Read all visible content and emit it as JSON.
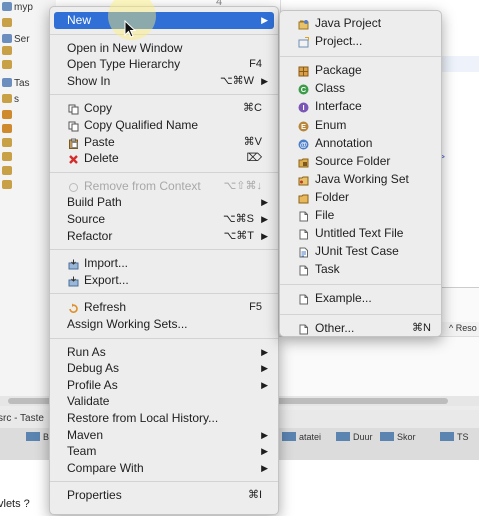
{
  "background": {
    "tree_rows": [
      {
        "label": "myp",
        "color": "#6c8ebf"
      },
      {
        "label": "",
        "color": "#c8a046"
      },
      {
        "label": "Ser",
        "color": "#6c8ebf"
      },
      {
        "label": "",
        "color": "#c8a046"
      },
      {
        "label": "",
        "color": "#c8a046"
      },
      {
        "label": "Tas",
        "color": "#6c8ebf"
      },
      {
        "label": "s",
        "color": "#c8a046"
      },
      {
        "label": "",
        "color": "#d08a2e"
      },
      {
        "label": "",
        "color": "#d08a2e"
      },
      {
        "label": "",
        "color": "#c8a046"
      },
      {
        "label": "",
        "color": "#c8a046"
      },
      {
        "label": "",
        "color": "#c8a046"
      },
      {
        "label": "",
        "color": "#c8a046"
      }
    ],
    "editor_line_number": "4",
    "code_fragment": ":/p>",
    "results_tab": "Reso",
    "bottom_tab": "src - Taste",
    "toolbar_items": [
      "Bra",
      "atatei",
      "Duur",
      "Skor",
      "TS"
    ],
    "bottom_text": "vlets ?"
  },
  "context_menu": {
    "items": [
      {
        "label": "New",
        "arrow": "▶",
        "selected": true
      },
      {
        "sep": true
      },
      {
        "label": "Open in New Window"
      },
      {
        "label": "Open Type Hierarchy",
        "shortcut": "F4"
      },
      {
        "label": "Show In",
        "shortcut": "⌥⌘W",
        "arrow": "▶"
      },
      {
        "sep": true
      },
      {
        "label": "Copy",
        "shortcut": "⌘C",
        "icon": "copy-icon"
      },
      {
        "label": "Copy Qualified Name",
        "icon": "copy-qualified-icon"
      },
      {
        "label": "Paste",
        "shortcut": "⌘V",
        "icon": "paste-icon"
      },
      {
        "label": "Delete",
        "shortcut": "⌦",
        "icon": "delete-icon"
      },
      {
        "sep": true
      },
      {
        "label": "Remove from Context",
        "shortcut": "⌥⇧⌘↓",
        "icon": "remove-context-icon",
        "disabled": true
      },
      {
        "label": "Build Path",
        "arrow": "▶"
      },
      {
        "label": "Source",
        "shortcut": "⌥⌘S",
        "arrow": "▶"
      },
      {
        "label": "Refactor",
        "shortcut": "⌥⌘T",
        "arrow": "▶"
      },
      {
        "sep": true
      },
      {
        "label": "Import...",
        "icon": "import-icon"
      },
      {
        "label": "Export...",
        "icon": "export-icon"
      },
      {
        "sep": true
      },
      {
        "label": "Refresh",
        "shortcut": "F5",
        "icon": "refresh-icon"
      },
      {
        "label": "Assign Working Sets..."
      },
      {
        "sep": true
      },
      {
        "label": "Run As",
        "arrow": "▶"
      },
      {
        "label": "Debug As",
        "arrow": "▶"
      },
      {
        "label": "Profile As",
        "arrow": "▶"
      },
      {
        "label": "Validate"
      },
      {
        "label": "Restore from Local History..."
      },
      {
        "label": "Maven",
        "arrow": "▶"
      },
      {
        "label": "Team",
        "arrow": "▶"
      },
      {
        "label": "Compare With",
        "arrow": "▶"
      },
      {
        "sep": true
      },
      {
        "label": "Properties",
        "shortcut": "⌘I"
      }
    ]
  },
  "new_submenu": {
    "items": [
      {
        "label": "Java Project",
        "icon": "java-project-icon"
      },
      {
        "label": "Project...",
        "icon": "project-icon"
      },
      {
        "sep": true
      },
      {
        "label": "Package",
        "icon": "package-icon"
      },
      {
        "label": "Class",
        "icon": "class-icon"
      },
      {
        "label": "Interface",
        "icon": "interface-icon"
      },
      {
        "label": "Enum",
        "icon": "enum-icon"
      },
      {
        "label": "Annotation",
        "icon": "annotation-icon"
      },
      {
        "label": "Source Folder",
        "icon": "source-folder-icon"
      },
      {
        "label": "Java Working Set",
        "icon": "java-working-set-icon"
      },
      {
        "label": "Folder",
        "icon": "folder-icon"
      },
      {
        "label": "File",
        "icon": "file-icon"
      },
      {
        "label": "Untitled Text File",
        "icon": "untitled-text-file-icon"
      },
      {
        "label": "JUnit Test Case",
        "icon": "junit-test-case-icon"
      },
      {
        "label": "Task",
        "icon": "task-icon"
      },
      {
        "sep": true
      },
      {
        "label": "Example...",
        "icon": "example-icon"
      },
      {
        "sep": true
      },
      {
        "label": "Other...",
        "shortcut": "⌘N",
        "icon": "other-icon"
      }
    ]
  },
  "colors": {
    "selection": "#2f6fd6",
    "menu_bg": "#ededed"
  }
}
